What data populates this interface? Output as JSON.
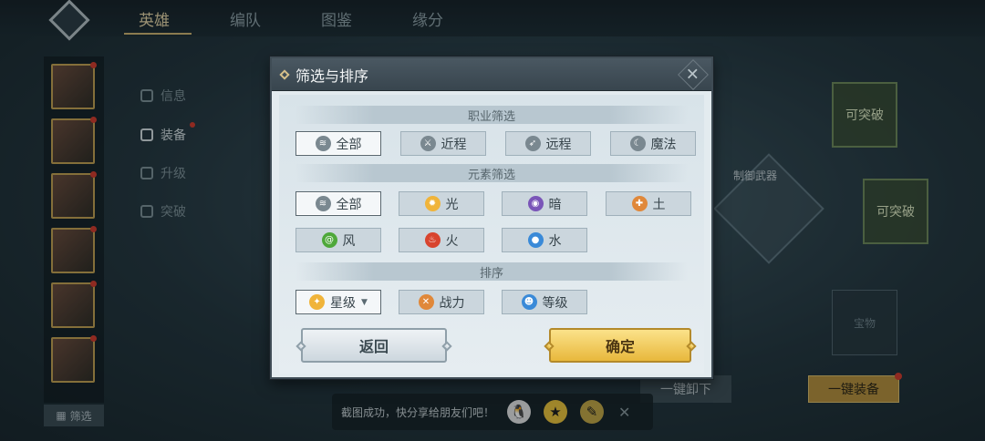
{
  "top_tabs": [
    "英雄",
    "编队",
    "图鉴",
    "缘分"
  ],
  "side_menu": [
    "信息",
    "装备",
    "升级",
    "突破"
  ],
  "left_filter_button": "筛选",
  "right_panel": {
    "breakthrough_slot_1": "可突破",
    "breakthrough_slot_2": "可突破",
    "lock_label": "制御武器",
    "treasure_label": "宝物",
    "unequip_all": "一键卸下",
    "equip_all": "一键装备"
  },
  "share_bar": {
    "text": "截图成功，快分享给朋友们吧！"
  },
  "dialog": {
    "title": "筛选与排序",
    "class_section": "职业筛选",
    "class_options": [
      {
        "label": "全部",
        "icon": "layers-icon",
        "color": "#7a8890"
      },
      {
        "label": "近程",
        "icon": "sword-icon",
        "color": "#7a8890"
      },
      {
        "label": "远程",
        "icon": "bow-icon",
        "color": "#7a8890"
      },
      {
        "label": "魔法",
        "icon": "magic-icon",
        "color": "#7a8890"
      }
    ],
    "element_section": "元素筛选",
    "element_options": [
      {
        "label": "全部",
        "icon": "layers-icon",
        "color": "#7a8890"
      },
      {
        "label": "光",
        "icon": "sun-icon",
        "color": "#f0b43a"
      },
      {
        "label": "暗",
        "icon": "dark-orb-icon",
        "color": "#7a55b8"
      },
      {
        "label": "土",
        "icon": "earth-icon",
        "color": "#e0883a"
      },
      {
        "label": "风",
        "icon": "wind-icon",
        "color": "#4ea83a"
      },
      {
        "label": "火",
        "icon": "fire-icon",
        "color": "#d8442e"
      },
      {
        "label": "水",
        "icon": "water-drop-icon",
        "color": "#3a8ad8"
      }
    ],
    "sort_section": "排序",
    "sort_options": [
      {
        "label": "星级",
        "icon": "star-icon",
        "color": "#f0b43a"
      },
      {
        "label": "战力",
        "icon": "crossed-swords-icon",
        "color": "#e0883a"
      },
      {
        "label": "等级",
        "icon": "person-icon",
        "color": "#3a8ad8"
      }
    ],
    "back_label": "返回",
    "confirm_label": "确定"
  }
}
